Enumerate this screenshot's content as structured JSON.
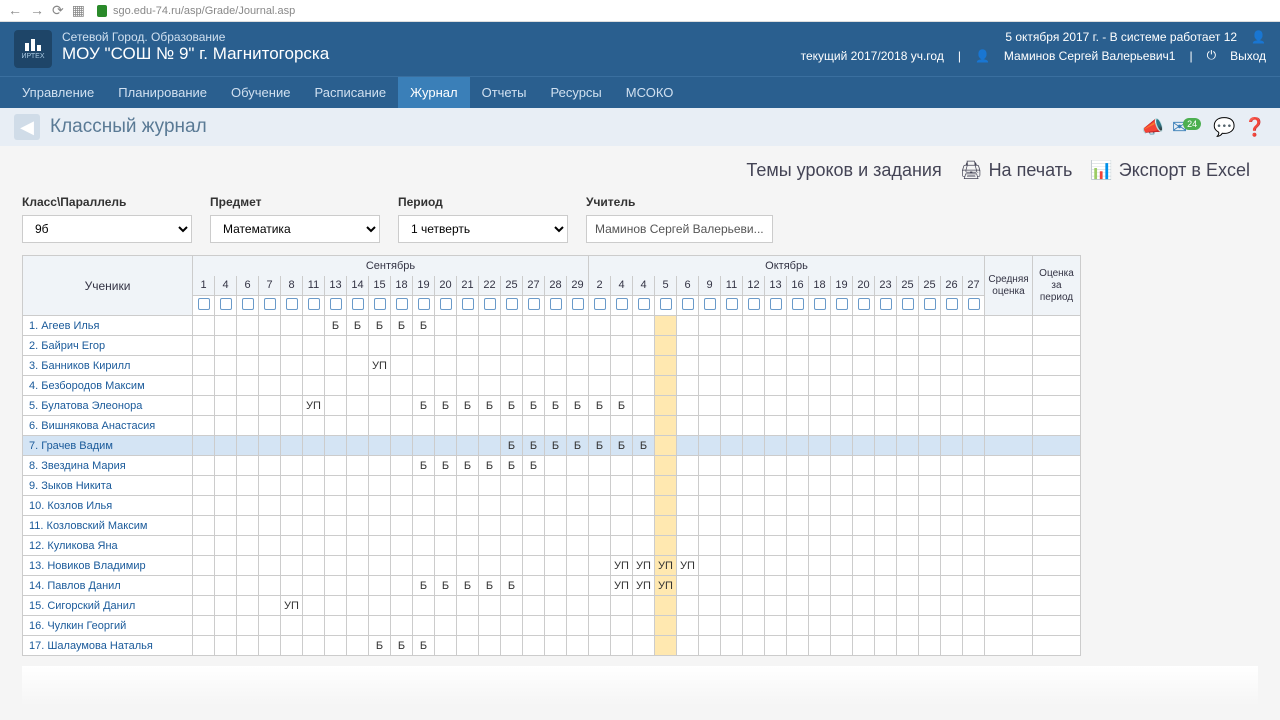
{
  "browser": {
    "url": "sgo.edu-74.ru/asp/Grade/Journal.asp"
  },
  "header": {
    "logo_text": "ИРТЕХ",
    "title_small": "Сетевой Город. Образование",
    "title_main": "МОУ \"СОШ № 9\" г. Магнитогорска",
    "date_status": "5 октября 2017 г. - В системе работает 12",
    "year": "текущий 2017/2018 уч.год",
    "user": "Маминов Сергей Валерьевич1",
    "exit": "Выход"
  },
  "nav": [
    "Управление",
    "Планирование",
    "Обучение",
    "Расписание",
    "Журнал",
    "Отчеты",
    "Ресурсы",
    "МСОКО"
  ],
  "nav_active": "Журнал",
  "page_title": "Классный журнал",
  "msg_badge": "24",
  "actions": {
    "topics": "Темы уроков и задания",
    "print": "На печать",
    "export": "Экспорт в Excel"
  },
  "filters": {
    "class": {
      "label": "Класс\\Параллель",
      "value": "9б"
    },
    "subject": {
      "label": "Предмет",
      "value": "Математика"
    },
    "period": {
      "label": "Период",
      "value": "1 четверть"
    },
    "teacher": {
      "label": "Учитель",
      "value": "Маминов Сергей Валерьеви..."
    }
  },
  "months": {
    "sep": {
      "name": "Сентябрь",
      "days": [
        "1",
        "4",
        "6",
        "7",
        "8",
        "11",
        "13",
        "14",
        "15",
        "18",
        "19",
        "20",
        "21",
        "22",
        "25",
        "27",
        "28",
        "29"
      ]
    },
    "oct": {
      "name": "Октябрь",
      "days": [
        "2",
        "4",
        "4",
        "5",
        "6",
        "9",
        "11",
        "12",
        "13",
        "16",
        "18",
        "19",
        "20",
        "23",
        "25",
        "25",
        "26",
        "27"
      ]
    }
  },
  "students_header": "Ученики",
  "avg_header": "Средняя оценка",
  "period_header": "Оценка за период",
  "students": [
    {
      "n": "1",
      "name": "Агеев Илья",
      "marks": {
        "sep": {
          "13": "Б",
          "14": "Б",
          "15": "Б",
          "18": "Б",
          "19": "Б"
        }
      }
    },
    {
      "n": "2",
      "name": "Байрич Егор",
      "marks": {}
    },
    {
      "n": "3",
      "name": "Банников Кирилл",
      "marks": {
        "sep": {
          "15": "УП"
        }
      }
    },
    {
      "n": "4",
      "name": "Безбородов Максим",
      "marks": {}
    },
    {
      "n": "5",
      "name": "Булатова Элеонора",
      "marks": {
        "sep": {
          "11": "УП",
          "19": "Б",
          "20": "Б",
          "21": "Б",
          "22": "Б",
          "25": "Б",
          "27": "Б",
          "28": "Б",
          "29": "Б"
        },
        "oct": {
          "2": "Б",
          "4": "Б"
        }
      }
    },
    {
      "n": "6",
      "name": "Вишнякова Анастасия",
      "marks": {}
    },
    {
      "n": "7",
      "name": "Грачев Вадим",
      "marks": {
        "sep": {
          "25": "Б",
          "27": "Б",
          "28": "Б",
          "29": "Б"
        },
        "oct": {
          "2": "Б",
          "4": "Б",
          "4b": "Б"
        }
      },
      "highlighted": true
    },
    {
      "n": "8",
      "name": "Звездина Мария",
      "marks": {
        "sep": {
          "19": "Б",
          "20": "Б",
          "21": "Б",
          "22": "Б",
          "25": "Б",
          "27": "Б"
        }
      }
    },
    {
      "n": "9",
      "name": "Зыков Никита",
      "marks": {}
    },
    {
      "n": "10",
      "name": "Козлов Илья",
      "marks": {}
    },
    {
      "n": "11",
      "name": "Козловский Максим",
      "marks": {}
    },
    {
      "n": "12",
      "name": "Куликова Яна",
      "marks": {}
    },
    {
      "n": "13",
      "name": "Новиков Владимир",
      "marks": {
        "oct": {
          "4": "УП",
          "4b": "УП",
          "5": "УП",
          "6": "УП"
        }
      }
    },
    {
      "n": "14",
      "name": "Павлов Данил",
      "marks": {
        "sep": {
          "19": "Б",
          "20": "Б",
          "21": "Б",
          "22": "Б",
          "25": "Б"
        },
        "oct": {
          "4": "УП",
          "4b": "УП",
          "5": "УП"
        }
      }
    },
    {
      "n": "15",
      "name": "Сигорский Данил",
      "marks": {
        "sep": {
          "8": "УП"
        }
      }
    },
    {
      "n": "16",
      "name": "Чулкин Георгий",
      "marks": {}
    },
    {
      "n": "17",
      "name": "Шалаумова Наталья",
      "marks": {
        "sep": {
          "15": "Б",
          "18": "Б",
          "19": "Б"
        }
      }
    }
  ]
}
